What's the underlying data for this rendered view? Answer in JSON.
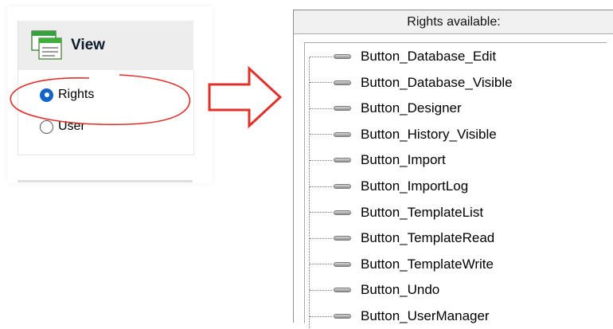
{
  "view_panel": {
    "title": "View",
    "icon": "view-window-icon",
    "options": [
      {
        "label": "Rights",
        "selected": true
      },
      {
        "label": "User",
        "selected": false
      }
    ],
    "highlight_color": "#e0302a"
  },
  "arrow": {
    "icon": "right-arrow-icon",
    "color": "#e0302a"
  },
  "rights_list": {
    "header": "Rights available:",
    "items": [
      "Button_Database_Edit",
      "Button_Database_Visible",
      "Button_Designer",
      "Button_History_Visible",
      "Button_Import",
      "Button_ImportLog",
      "Button_TemplateList",
      "Button_TemplateRead",
      "Button_TemplateWrite",
      "Button_Undo",
      "Button_UserManager"
    ],
    "item_icon": "right-item-icon"
  }
}
